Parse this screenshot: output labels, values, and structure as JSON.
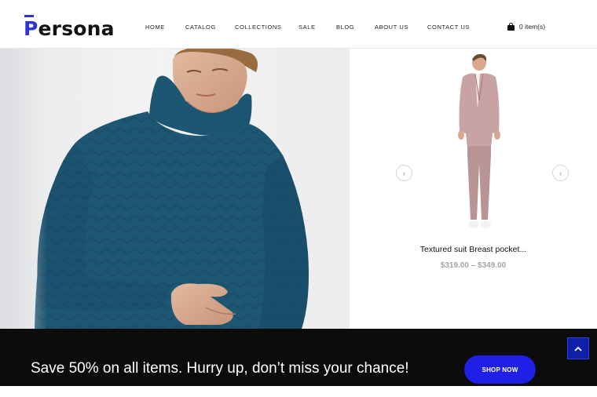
{
  "brand": {
    "logo_text": "ersona",
    "logo_initial": "P"
  },
  "nav": {
    "items": [
      {
        "label": "HOME"
      },
      {
        "label": "CATALOG"
      },
      {
        "label": "COLLECTIONS"
      },
      {
        "label": "SALE"
      },
      {
        "label": "BLOG"
      },
      {
        "label": "ABOUT US"
      },
      {
        "label": "CONTACT US"
      }
    ]
  },
  "cart": {
    "label": "0 item(s)",
    "icon": "shopping-bag-icon"
  },
  "carousel": {
    "prev_icon": "chevron-left-icon",
    "next_icon": "chevron-right-icon",
    "prev_glyph": "‹",
    "next_glyph": "›"
  },
  "product": {
    "title": "Textured suit Breast pocket...",
    "price": "$319.00 – $349.00"
  },
  "promo": {
    "text": "Save 50% on all items. Hurry up, don’t miss your chance!",
    "button_label": "SHOP NOW"
  },
  "colors": {
    "brand_blue": "#2a34d8",
    "button_blue": "#1f1fe6",
    "scroll_top_blue": "#0e1fa8",
    "sweater_teal": "#1e5773",
    "suit_pink": "#c9a3a3",
    "banner_black": "#0c0c0c"
  }
}
